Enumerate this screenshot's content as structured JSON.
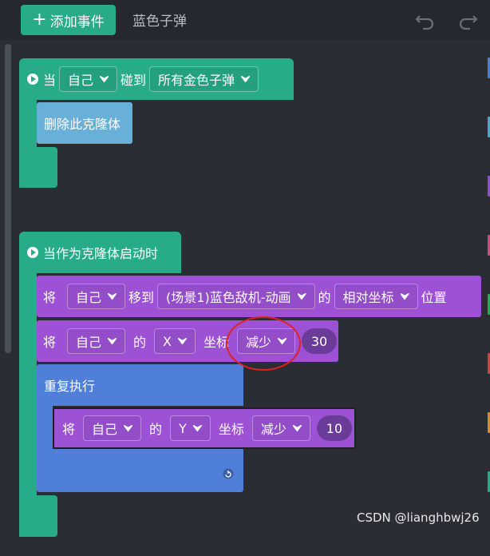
{
  "toolbar": {
    "add_label": "添加事件",
    "sprite_name": "蓝色子弹"
  },
  "script1": {
    "when": "当",
    "target": "自己",
    "touch": "碰到",
    "object": "所有金色子弹",
    "delete_clone": "删除此克隆体"
  },
  "script2": {
    "hat": "当作为克隆体启动时",
    "line1": {
      "kw": "将",
      "target": "自己",
      "move_to": "移到",
      "dest": "(场景1)蓝色敌机-动画",
      "of": "的",
      "rel": "相对坐标",
      "pos": "位置"
    },
    "line2": {
      "kw": "将",
      "target": "自己",
      "of": "的",
      "axis": "X",
      "coord": "坐标",
      "op": "减少",
      "value": "30"
    },
    "repeat": "重复执行",
    "line3": {
      "kw": "将",
      "target": "自己",
      "of": "的",
      "axis": "Y",
      "coord": "坐标",
      "op": "减少",
      "value": "10"
    }
  },
  "watermark": "CSDN @lianghbwj26",
  "colors": {
    "event": "#27ab88",
    "looks": "#9d52d6",
    "control": "#4f7fd8",
    "sensing": "#69b0d8",
    "highlight": "#e02020"
  }
}
